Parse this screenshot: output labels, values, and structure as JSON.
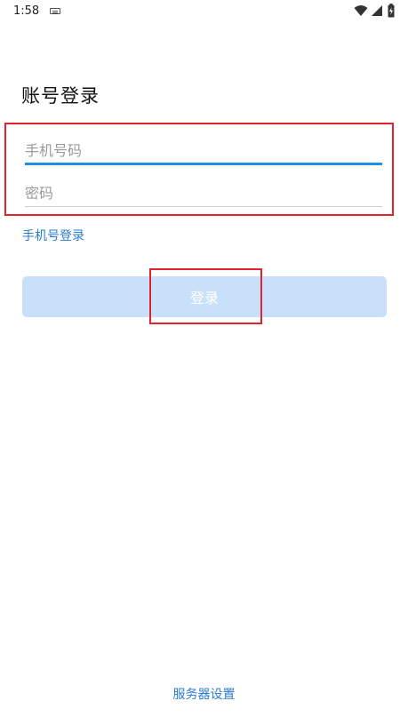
{
  "status_bar": {
    "time": "1:58",
    "icons": [
      "keyboard-icon",
      "wifi-icon",
      "signal-icon",
      "battery-charging-icon"
    ]
  },
  "page": {
    "title": "账号登录"
  },
  "form": {
    "phone_placeholder": "手机号码",
    "phone_value": "",
    "password_placeholder": "密码",
    "password_value": "",
    "phone_login_link": "手机号登录",
    "login_button": "登录"
  },
  "footer": {
    "server_settings": "服务器设置"
  },
  "colors": {
    "accent": "#1f8ee6",
    "link": "#2a7bd1",
    "button_disabled": "#c9e0fb",
    "highlight": "#e3232b"
  }
}
